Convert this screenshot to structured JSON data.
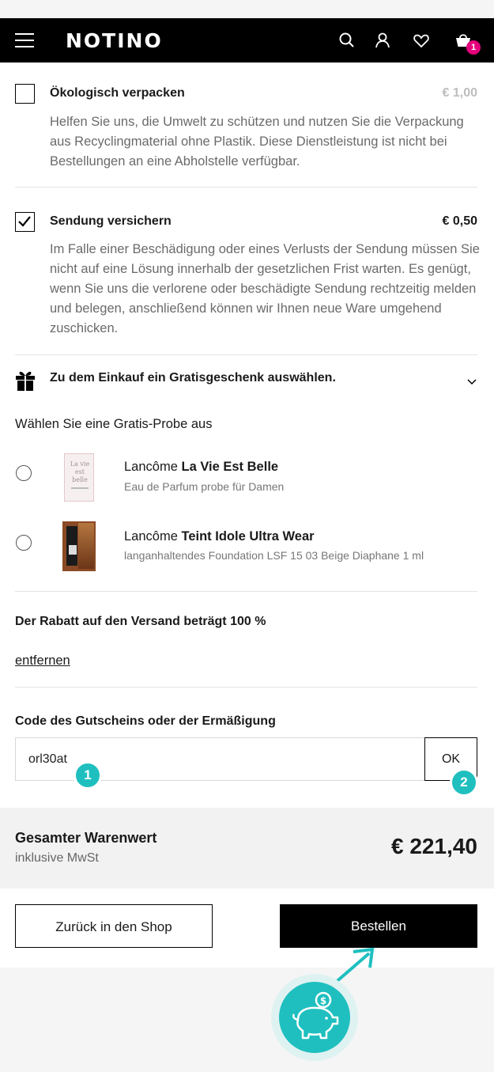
{
  "header": {
    "logo": "NOTINO",
    "cart_count": "1"
  },
  "options": {
    "eco": {
      "title": "Ökologisch verpacken",
      "price": "€ 1,00",
      "description": "Helfen Sie uns, die Umwelt zu schützen und nutzen Sie die Verpackung aus Recyclingmaterial ohne Plastik. Diese Dienstleistung ist nicht bei Bestellungen an eine Abholstelle verfügbar.",
      "checked": false
    },
    "insurance": {
      "title": "Sendung versichern",
      "price": "€ 0,50",
      "description": "Im Falle einer Beschädigung oder eines Verlusts der Sendung müssen Sie nicht auf eine Lösung innerhalb der gesetzlichen Frist warten. Es genügt, wenn Sie uns die verlorene oder beschädigte Sendung rechtzeitig melden und belegen, anschließend können wir Ihnen neue Ware umgehend zuschicken.",
      "checked": true
    }
  },
  "gift": {
    "title": "Zu dem Einkauf ein Gratisgeschenk auswählen.",
    "sample_heading": "Wählen Sie eine Gratis-Probe aus",
    "sample_image_text": "La vie est belle",
    "samples": [
      {
        "brand": "Lancôme",
        "name": "La Vie Est Belle",
        "subtitle": "Eau de Parfum probe für Damen"
      },
      {
        "brand": "Lancôme",
        "name": "Teint Idole Ultra Wear",
        "subtitle": "langanhaltendes Foundation LSF 15 03 Beige Diaphane 1 ml"
      }
    ]
  },
  "discount": {
    "text": "Der Rabatt auf den Versand beträgt 100 %",
    "remove_link": "entfernen"
  },
  "voucher": {
    "label": "Code des Gutscheins oder der Ermäßigung",
    "value": "orl30at",
    "ok_label": "OK",
    "step1": "1",
    "step2": "2"
  },
  "summary": {
    "title": "Gesamter Warenwert",
    "subtitle": "inklusive MwSt",
    "total": "€ 221,40"
  },
  "actions": {
    "back_label": "Zurück in den Shop",
    "order_label": "Bestellen"
  },
  "colors": {
    "accent_teal": "#1fbfbf",
    "badge_pink": "#e4007d"
  }
}
